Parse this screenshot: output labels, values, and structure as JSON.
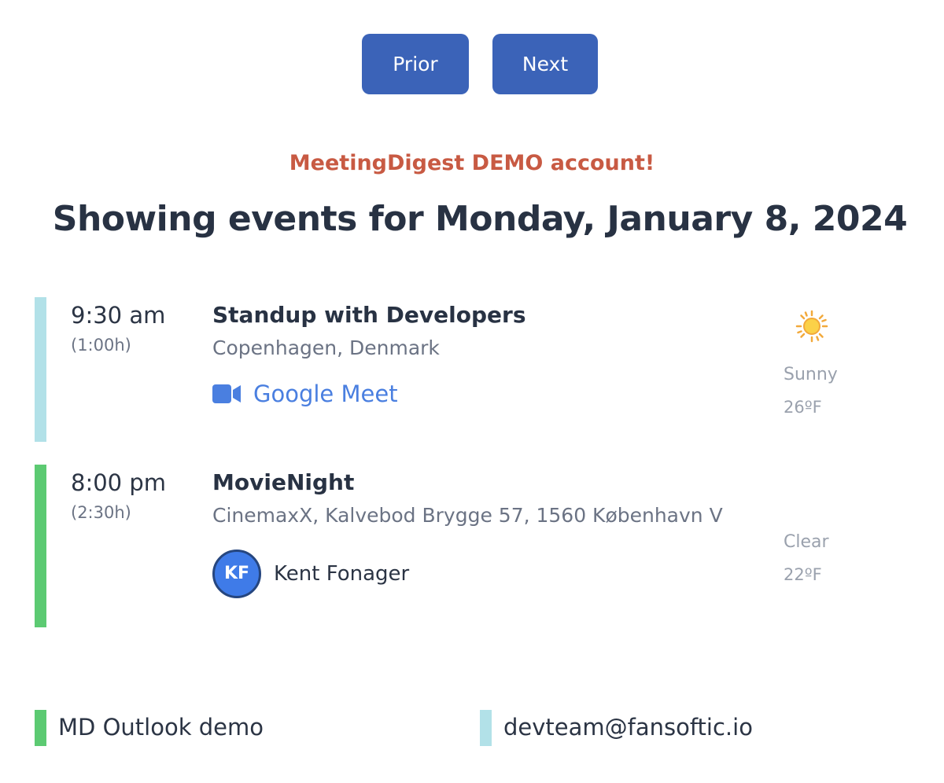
{
  "nav": {
    "prior_label": "Prior",
    "next_label": "Next"
  },
  "banner": "MeetingDigest DEMO account!",
  "title": "Showing events for Monday, January 8, 2024",
  "events": [
    {
      "time": "9:30 am",
      "duration": "(1:00h)",
      "title": "Standup with Developers",
      "location": "Copenhagen, Denmark",
      "link_label": "Google Meet",
      "bar_color": "#b2e1e8",
      "weather": {
        "icon": "sun-icon",
        "condition": "Sunny",
        "temp": "26ºF"
      }
    },
    {
      "time": "8:00 pm",
      "duration": "(2:30h)",
      "title": "MovieNight",
      "location": "CinemaxX, Kalvebod Brygge 57, 1560 København V",
      "attendee_initials": "KF",
      "attendee_name": "Kent Fonager",
      "bar_color": "#5cca72",
      "weather": {
        "icon": "moon-icon",
        "condition": "Clear",
        "temp": "22ºF"
      }
    }
  ],
  "calendars": [
    {
      "name": "MD Outlook demo",
      "color": "#5cca72"
    },
    {
      "name": "devteam@fansoftic.io",
      "color": "#b2e1e8"
    }
  ],
  "colors": {
    "primary_button": "#3b63b8",
    "banner": "#c85a43",
    "link": "#4a7fe0"
  }
}
